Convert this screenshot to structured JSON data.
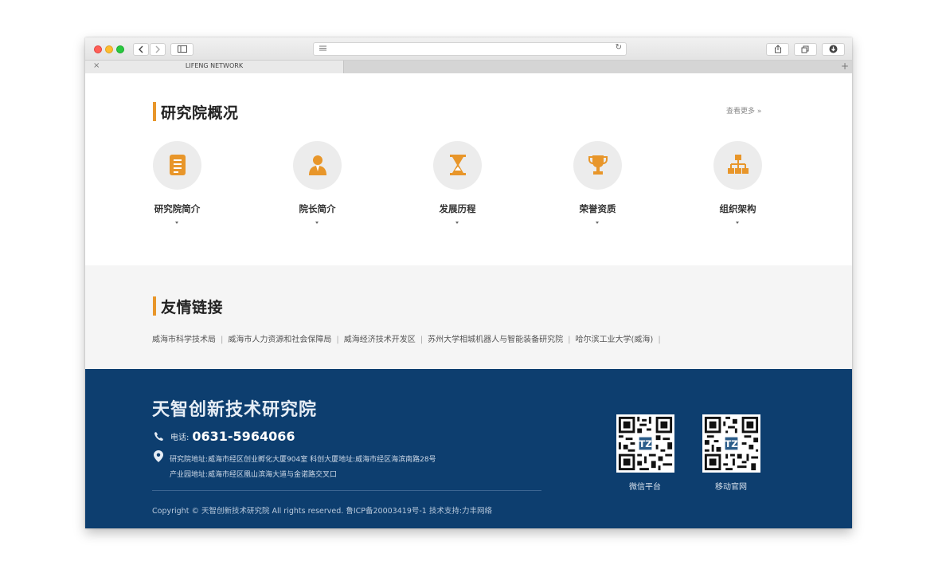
{
  "browser": {
    "tab_title": "LIFENG NETWORK",
    "tab_close": "×",
    "new_tab": "+",
    "reload": "↻"
  },
  "overview": {
    "title": "研究院概况",
    "more": "查看更多 »",
    "items": [
      {
        "label": "研究院简介",
        "icon": "document-icon"
      },
      {
        "label": "院长简介",
        "icon": "person-icon"
      },
      {
        "label": "发展历程",
        "icon": "hourglass-icon"
      },
      {
        "label": "荣誉资质",
        "icon": "trophy-icon"
      },
      {
        "label": "组织架构",
        "icon": "org-chart-icon"
      }
    ]
  },
  "friend_links": {
    "title": "友情链接",
    "items": [
      "威海市科学技术局",
      "威海市人力资源和社会保障局",
      "威海经济技术开发区",
      "苏州大学相城机器人与智能装备研究院",
      "哈尔滨工业大学(威海)"
    ],
    "separator": "|"
  },
  "footer": {
    "org_name": "天智创新技术研究院",
    "phone_label": "电话:",
    "phone": "0631-5964066",
    "address1": "研究院地址:威海市经区创业孵化大厦904室    科创大厦地址:威海市经区海滨南路28号",
    "address2": "产业园地址:威海市经区凰山滨海大道与金诺路交叉口",
    "copyright": "Copyright © 天智创新技术研究院 All rights reserved.   鲁ICP备20003419号-1   技术支持:力丰网络",
    "qr_codes": [
      {
        "label": "微信平台"
      },
      {
        "label": "移动官网"
      }
    ]
  },
  "colors": {
    "accent": "#e8962a",
    "footer_bg": "#0d3e6f",
    "links_bg": "#f5f5f5"
  }
}
